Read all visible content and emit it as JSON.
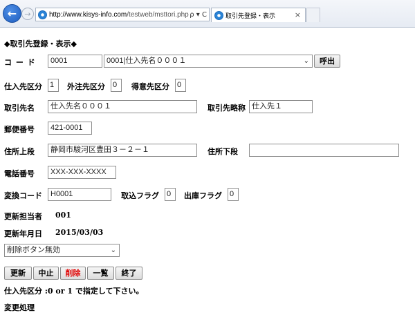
{
  "browser": {
    "url_host": "http://www.kisys-info.com",
    "url_path": "/testweb/msttori.php",
    "addr_tools": "ρ ▾ C",
    "tab_title": "取引先登録・表示",
    "tab_close": "×"
  },
  "page": {
    "heading": "◆取引先登録・表示◆",
    "code": {
      "label": "コ ー ド",
      "value": "0001",
      "select_value": "0001|仕入先名０００１",
      "call_button": "呼出"
    },
    "kubun": {
      "shiire_label": "仕入先区分",
      "shiire_value": "1",
      "gaichu_label": "外注先区分",
      "gaichu_value": "0",
      "tokui_label": "得意先区分",
      "tokui_value": "0"
    },
    "torihiki": {
      "name_label": "取引先名",
      "name_value": "仕入先名０００１",
      "short_label": "取引先略称",
      "short_value": "仕入先１"
    },
    "postal": {
      "label": "郵便番号",
      "value": "421-0001"
    },
    "address": {
      "upper_label": "住所上段",
      "upper_value": "静岡市駿河区豊田３－２－１",
      "lower_label": "住所下段",
      "lower_value": ""
    },
    "phone": {
      "label": "電話番号",
      "value": "XXX-XXX-XXXX"
    },
    "henkan": {
      "label": "変換コード",
      "value": "H0001",
      "torikomi_label": "取込フラグ",
      "torikomi_value": "0",
      "shukko_label": "出庫フラグ",
      "shukko_value": "0"
    },
    "updater": {
      "label": "更新担当者",
      "value": "001"
    },
    "update_date": {
      "label": "更新年月日",
      "value": "2015/03/03"
    },
    "delete_select": {
      "value": "削除ボタン無効"
    },
    "buttons": {
      "update": "更新",
      "cancel": "中止",
      "delete": "削除",
      "list": "一覧",
      "exit": "終了"
    },
    "message": "仕入先区分 :0 or 1 で指定して下さい。",
    "mode": "変更処理"
  },
  "colors": {
    "delete_text": "#e00000",
    "accent": "#1d5dbf"
  }
}
